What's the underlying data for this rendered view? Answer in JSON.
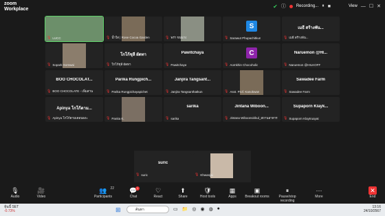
{
  "app": {
    "logo_top": "zoom",
    "logo_bottom": "Workplace"
  },
  "titlebar": {
    "recording": "Recording...",
    "view": "View"
  },
  "tiles": [
    {
      "label": "LUCC",
      "big": "",
      "kind": "video",
      "avatar": ""
    },
    {
      "label": "น้ำใส | Rose Cocoa Garden",
      "big": "",
      "kind": "video",
      "avatar": ""
    },
    {
      "label": "พร่า ขนนาง",
      "big": "",
      "kind": "video",
      "avatar": ""
    },
    {
      "label": "Sarawut Phupachitkun",
      "big": "",
      "kind": "avatar",
      "avatar": "S",
      "color": "#1e88e5"
    },
    {
      "label": "เมธี สร้างพัน...",
      "big": "เมธี สร้างพัน...",
      "kind": "name",
      "avatar": ""
    },
    {
      "label": "Sopark Somwai",
      "big": "",
      "kind": "video",
      "avatar": ""
    },
    {
      "label": "ใกโก้ชุลี ผัดทา",
      "big": "โกโก้ชุลี ผัดทา",
      "kind": "name",
      "avatar": ""
    },
    {
      "label": "Pawitchaya",
      "big": "Pawitchaya",
      "kind": "name",
      "avatar": ""
    },
    {
      "label": "Aomkhin Chocoholic",
      "big": "",
      "kind": "avatar",
      "avatar": "C",
      "color": "#8e24aa"
    },
    {
      "label": "Naruemon @HILKOFF",
      "big": "Naruemon @HI...",
      "kind": "name",
      "avatar": ""
    },
    {
      "label": "BOO CHOCOLATE - เพิ่มสาน",
      "big": "BOO CHOCOLAT...",
      "kind": "name",
      "avatar": ""
    },
    {
      "label": "Parika Rungpichayapichet",
      "big": "Parika Rungpich...",
      "kind": "name",
      "avatar": ""
    },
    {
      "label": "Janjira Tangsanthatkun",
      "big": "Janjira Tangsant...",
      "kind": "name",
      "avatar": ""
    },
    {
      "label": "Asst. Prof. Kanokwan",
      "big": "",
      "kind": "video",
      "avatar": ""
    },
    {
      "label": "Sawadee Farm",
      "big": "Sawadee Farm",
      "kind": "name",
      "avatar": ""
    },
    {
      "label": "Apinya โกโก้ตามเดอนองะ",
      "big": "Apinya โกโก้ตาม...",
      "kind": "name",
      "avatar": ""
    },
    {
      "label": "Panita K.",
      "big": "",
      "kind": "video",
      "avatar": ""
    },
    {
      "label": "sarika",
      "big": "sarika",
      "kind": "name",
      "avatar": ""
    },
    {
      "label": "Jintana Wiboonsirikul_สถานอาหาร",
      "big": "Jintana Wiboon...",
      "kind": "name",
      "avatar": ""
    },
    {
      "label": "Supaporn Klaytruayat",
      "big": "Supaporn Klayk...",
      "kind": "name",
      "avatar": ""
    }
  ],
  "bottom_tiles": [
    {
      "label": "suric",
      "big": "suric"
    },
    {
      "label": "Khwanjai",
      "big": ""
    }
  ],
  "toolbar": [
    {
      "label": "Audio",
      "icon": "🎙"
    },
    {
      "label": "Video",
      "icon": "🎥"
    },
    {
      "label": "Participants",
      "icon": "👥",
      "count": "22"
    },
    {
      "label": "Chat",
      "icon": "💬",
      "badge": "1"
    },
    {
      "label": "React",
      "icon": "♡"
    },
    {
      "label": "Share",
      "icon": "⬆"
    },
    {
      "label": "Host tools",
      "icon": "🛡"
    },
    {
      "label": "Apps",
      "icon": "▦"
    },
    {
      "label": "Breakout rooms",
      "icon": "▣"
    },
    {
      "label": "Pause/stop recording",
      "icon": "⏸"
    },
    {
      "label": "More",
      "icon": "⋯"
    },
    {
      "label": "End",
      "icon": "✕"
    }
  ],
  "taskbar": {
    "weather": "หุ้นนี้ SET",
    "weather_sub": "-0.73%",
    "search": "ค้นหา",
    "time": "13:16",
    "date": "24/10/2567"
  },
  "colors": {
    "recording": "#e33333",
    "active_border": "#5fd36a"
  }
}
